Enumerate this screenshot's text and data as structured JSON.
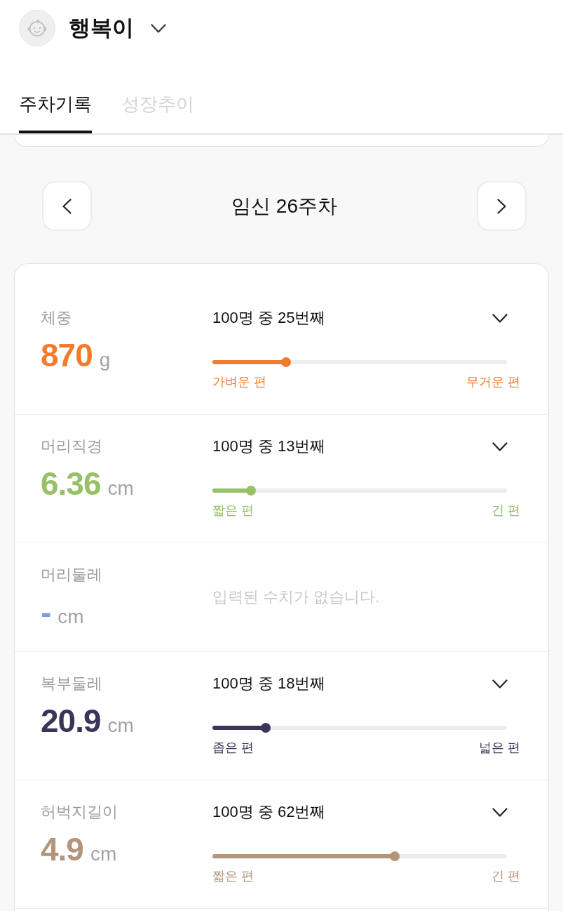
{
  "profile": {
    "name": "행복이"
  },
  "tabs": [
    {
      "label": "주차기록",
      "selected": true
    },
    {
      "label": "성장추이",
      "selected": false
    }
  ],
  "week_nav": {
    "title": "임신 26주차"
  },
  "measurements": [
    {
      "kind": "ranked",
      "label": "체중",
      "value": "870",
      "unit": "g",
      "color": "#f07d2e",
      "rank": "100명 중 25번째",
      "level": 0.25,
      "low_label": "가벼운 편",
      "high_label": "무거운 편"
    },
    {
      "kind": "ranked",
      "label": "머리직경",
      "value": "6.36",
      "unit": "cm",
      "color": "#96c166",
      "rank": "100명 중 13번째",
      "level": 0.13,
      "low_label": "짧은 편",
      "high_label": "긴 편"
    },
    {
      "kind": "empty",
      "label": "머리둘레",
      "value": "-",
      "unit": "cm",
      "color": "#7f9ed5",
      "message": "입력된 수치가 없습니다."
    },
    {
      "kind": "ranked",
      "label": "복부둘레",
      "value": "20.9",
      "unit": "cm",
      "color": "#3b3659",
      "rank": "100명 중 18번째",
      "level": 0.18,
      "low_label": "좁은 편",
      "high_label": "넓은 편"
    },
    {
      "kind": "ranked",
      "label": "허벅지길이",
      "value": "4.9",
      "unit": "cm",
      "color": "#b3957b",
      "rank": "100명 중 62번째",
      "level": 0.62,
      "low_label": "짧은 편",
      "high_label": "긴 편"
    }
  ]
}
